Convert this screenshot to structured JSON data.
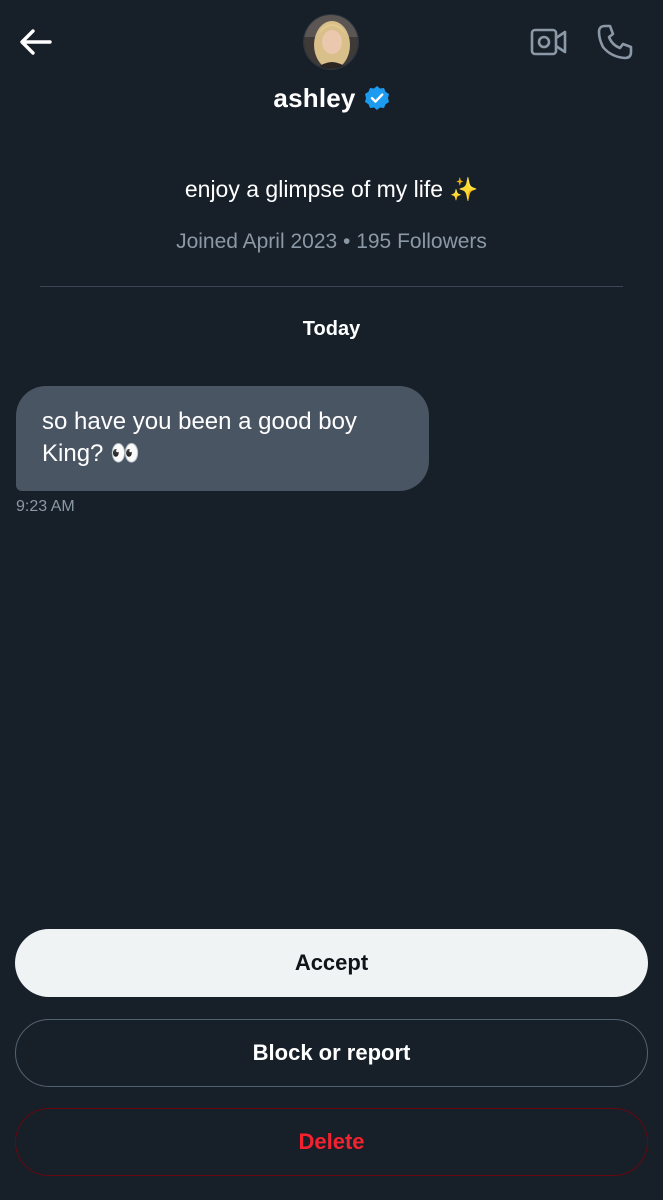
{
  "header": {
    "back_icon": "arrow-left-icon",
    "video_icon": "video-camera-icon",
    "call_icon": "phone-icon",
    "name": "ashley",
    "verified_icon": "verified-badge-icon",
    "verified_color": "#1d9bf0"
  },
  "profile": {
    "bio_text": "enjoy a glimpse of my life ",
    "bio_emoji": "✨",
    "meta": "Joined April 2023 • 195 Followers"
  },
  "conversation": {
    "day_label": "Today",
    "messages": [
      {
        "text": "so have you been a good boy King? 👀",
        "time": "9:23 AM"
      }
    ]
  },
  "actions": {
    "accept_label": "Accept",
    "block_label": "Block or report",
    "delete_label": "Delete"
  },
  "colors": {
    "background": "#171f29",
    "bubble": "#4a5563",
    "secondary_text": "#8b98a5",
    "delete_red": "#f4212e"
  }
}
